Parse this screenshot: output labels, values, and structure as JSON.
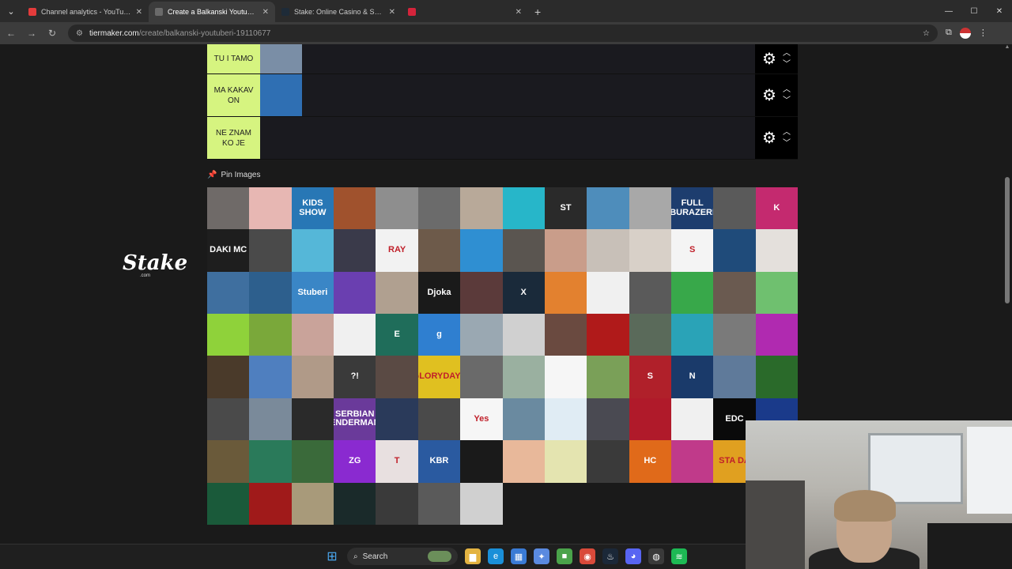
{
  "browser": {
    "tabs": [
      {
        "label": "Channel analytics - YouTube St",
        "favicon_color": "#e33b3b",
        "active": false
      },
      {
        "label": "Create a Balkanski Youtuberi Ti",
        "favicon_color": "#6a6a6a",
        "active": true
      },
      {
        "label": "Stake: Online Casino & Sports",
        "favicon_color": "#1e2b38",
        "active": false
      },
      {
        "label": "",
        "favicon_color": "#d4243b",
        "active": false
      }
    ],
    "close_glyph": "✕",
    "new_tab_glyph": "+",
    "url_host": "tiermaker.com",
    "url_path": "/create/balkanski-youtuberi-19110677"
  },
  "sidebar": {
    "brand": "Stake",
    "brand_sub": ".com"
  },
  "tiers": [
    {
      "label": "TU I TAMO",
      "thumbs": [
        "#7a8ea6"
      ]
    },
    {
      "label": "MA KAKAV ON",
      "thumbs": [
        "#2f6fb3"
      ]
    },
    {
      "label": "NE ZNAM KO JE",
      "thumbs": []
    }
  ],
  "pin_images": {
    "label": "Pin Images",
    "tiles": [
      {
        "color": "#6f6a68",
        "text": ""
      },
      {
        "color": "#e7b7b3",
        "text": ""
      },
      {
        "color": "#2877b5",
        "text": "KIDS SHOW"
      },
      {
        "color": "#a0522d",
        "text": ""
      },
      {
        "color": "#8e8e8e",
        "text": ""
      },
      {
        "color": "#6b6b6b",
        "text": ""
      },
      {
        "color": "#b8a999",
        "text": ""
      },
      {
        "color": "#27b6c9",
        "text": ""
      },
      {
        "color": "#2a2a2a",
        "text": "ST"
      },
      {
        "color": "#4e8dbb",
        "text": ""
      },
      {
        "color": "#a8a8a8",
        "text": ""
      },
      {
        "color": "#1d3d6e",
        "text": "FULL BURAZERI"
      },
      {
        "color": "#5a5a5a",
        "text": ""
      },
      {
        "color": "#c42a6f",
        "text": "K"
      },
      {
        "color": "#1e1e1e",
        "text": "DAKI MC"
      },
      {
        "color": "#4a4a4a",
        "text": ""
      },
      {
        "color": "#55b7d8",
        "text": ""
      },
      {
        "color": "#3a3a4a",
        "text": ""
      },
      {
        "color": "#f2f2f2",
        "text": "RAY"
      },
      {
        "color": "#6d5a4a",
        "text": ""
      },
      {
        "color": "#2f8fd2",
        "text": ""
      },
      {
        "color": "#5a5550",
        "text": ""
      },
      {
        "color": "#c99d8a",
        "text": ""
      },
      {
        "color": "#c8c0b8",
        "text": ""
      },
      {
        "color": "#d8d0c8",
        "text": ""
      },
      {
        "color": "#f4f4f4",
        "text": "S"
      },
      {
        "color": "#1f4b7a",
        "text": ""
      },
      {
        "color": "#e4e0dc",
        "text": ""
      },
      {
        "color": "#3f6f9f",
        "text": ""
      },
      {
        "color": "#2d5f8d",
        "text": ""
      },
      {
        "color": "#3a86c6",
        "text": "Stuberi"
      },
      {
        "color": "#6a3fb0",
        "text": ""
      },
      {
        "color": "#b0a090",
        "text": ""
      },
      {
        "color": "#1a1a1a",
        "text": "Djoka"
      },
      {
        "color": "#5b3a3a",
        "text": ""
      },
      {
        "color": "#1a2a3a",
        "text": "X"
      },
      {
        "color": "#e3812f",
        "text": ""
      },
      {
        "color": "#f0f0f0",
        "text": ""
      },
      {
        "color": "#5a5a5a",
        "text": ""
      },
      {
        "color": "#38a84a",
        "text": ""
      },
      {
        "color": "#6a5a50",
        "text": ""
      },
      {
        "color": "#6fc06f",
        "text": ""
      },
      {
        "color": "#8fd23a",
        "text": ""
      },
      {
        "color": "#7aa83a",
        "text": ""
      },
      {
        "color": "#c9a39a",
        "text": ""
      },
      {
        "color": "#f0f0f0",
        "text": ""
      },
      {
        "color": "#1f6d5a",
        "text": "E"
      },
      {
        "color": "#2f7fd0",
        "text": "g"
      },
      {
        "color": "#9aa8b2",
        "text": ""
      },
      {
        "color": "#d0d0d0",
        "text": ""
      },
      {
        "color": "#6a4a40",
        "text": ""
      },
      {
        "color": "#b01a1a",
        "text": ""
      },
      {
        "color": "#5a6a5a",
        "text": ""
      },
      {
        "color": "#2aa3b7",
        "text": ""
      },
      {
        "color": "#7a7a7a",
        "text": ""
      },
      {
        "color": "#b02ab0",
        "text": ""
      },
      {
        "color": "#4a3a2a",
        "text": ""
      },
      {
        "color": "#4f7fbf",
        "text": ""
      },
      {
        "color": "#b09a88",
        "text": ""
      },
      {
        "color": "#3a3a3a",
        "text": "?!"
      },
      {
        "color": "#5a4a44",
        "text": ""
      },
      {
        "color": "#e0c020",
        "text": "GLORYDAYZ"
      },
      {
        "color": "#6a6a6a",
        "text": ""
      },
      {
        "color": "#9ab0a0",
        "text": ""
      },
      {
        "color": "#f6f6f6",
        "text": ""
      },
      {
        "color": "#7aa058",
        "text": ""
      },
      {
        "color": "#b0202a",
        "text": "S"
      },
      {
        "color": "#1a3a6a",
        "text": "N"
      },
      {
        "color": "#5f7a9a",
        "text": ""
      },
      {
        "color": "#2a6a2a",
        "text": ""
      },
      {
        "color": "#4a4a4a",
        "text": ""
      },
      {
        "color": "#7a8a9a",
        "text": ""
      },
      {
        "color": "#2a2a2a",
        "text": ""
      },
      {
        "color": "#6a3a9a",
        "text": "SERBIAN ENDERMAN"
      },
      {
        "color": "#2a3a5a",
        "text": ""
      },
      {
        "color": "#4a4a4a",
        "text": ""
      },
      {
        "color": "#f6f6f6",
        "text": "Yes"
      },
      {
        "color": "#6a8aa0",
        "text": ""
      },
      {
        "color": "#e0ecf4",
        "text": ""
      },
      {
        "color": "#4a4a52",
        "text": ""
      },
      {
        "color": "#b01a2a",
        "text": ""
      },
      {
        "color": "#f0f0f0",
        "text": ""
      },
      {
        "color": "#0a0a0a",
        "text": "EDC"
      },
      {
        "color": "#1a3a8a",
        "text": ""
      },
      {
        "color": "#6a5a3a",
        "text": ""
      },
      {
        "color": "#2a7a5a",
        "text": ""
      },
      {
        "color": "#3a6a3a",
        "text": ""
      },
      {
        "color": "#8a2ad0",
        "text": "ZG"
      },
      {
        "color": "#e8e0e0",
        "text": "T"
      },
      {
        "color": "#2a5aa0",
        "text": "KBR"
      },
      {
        "color": "#1a1a1a",
        "text": ""
      },
      {
        "color": "#e8b89a",
        "text": ""
      },
      {
        "color": "#e4e4b0",
        "text": ""
      },
      {
        "color": "#3a3a3a",
        "text": ""
      },
      {
        "color": "#e06a1a",
        "text": "HC"
      },
      {
        "color": "#c03a8a",
        "text": ""
      },
      {
        "color": "#e0a020",
        "text": "STA DA"
      },
      {
        "color": "#3a3a4a",
        "text": ""
      },
      {
        "color": "#1a5a3a",
        "text": ""
      },
      {
        "color": "#a01a1a",
        "text": ""
      },
      {
        "color": "#a89a7a",
        "text": ""
      },
      {
        "color": "#1a2a2a",
        "text": ""
      },
      {
        "color": "#3a3a3a",
        "text": ""
      },
      {
        "color": "#5a5a5a",
        "text": ""
      },
      {
        "color": "#d0d0d0",
        "text": ""
      }
    ]
  },
  "taskbar": {
    "search_label": "Search",
    "icons": [
      {
        "name": "file-explorer-icon",
        "color": "#e3b341",
        "glyph": "▆"
      },
      {
        "name": "edge-icon",
        "color": "#1a8fd8",
        "glyph": "e"
      },
      {
        "name": "store-icon",
        "color": "#3a7bd5",
        "glyph": "▦"
      },
      {
        "name": "app-icon",
        "color": "#5a8ae0",
        "glyph": "✦"
      },
      {
        "name": "minecraft-icon",
        "color": "#4aa34a",
        "glyph": "■"
      },
      {
        "name": "chrome-icon",
        "color": "#d94a3a",
        "glyph": "◉"
      },
      {
        "name": "steam-icon",
        "color": "#1b2838",
        "glyph": "♨"
      },
      {
        "name": "discord-icon",
        "color": "#5865f2",
        "glyph": "◕"
      },
      {
        "name": "obs-icon",
        "color": "#3a3a3a",
        "glyph": "◍"
      },
      {
        "name": "spotify-icon",
        "color": "#1db954",
        "glyph": "≋"
      }
    ]
  }
}
